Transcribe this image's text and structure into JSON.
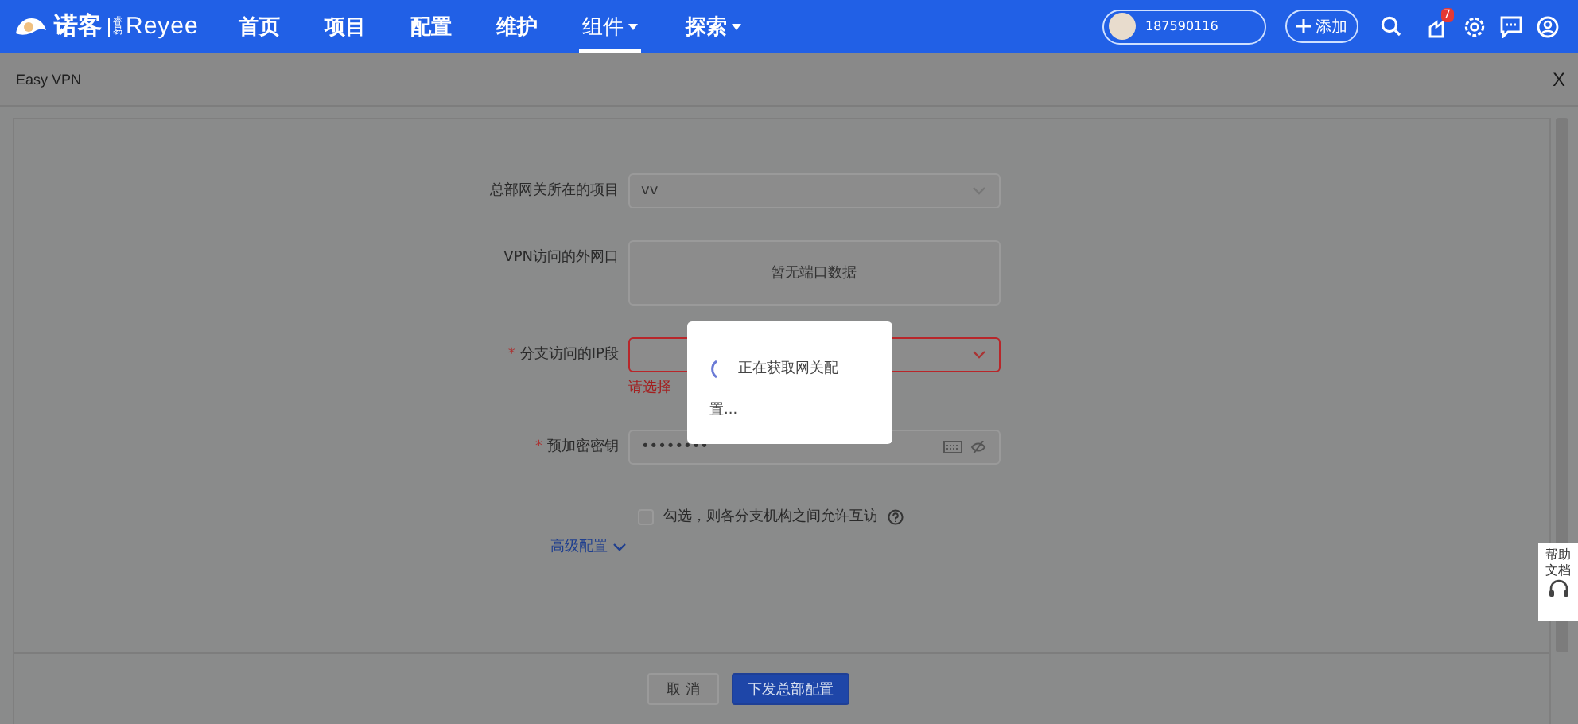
{
  "logo": {
    "name": "诺客",
    "sub": "睿易",
    "brand": "Reyee"
  },
  "nav": [
    {
      "label": "首页",
      "selected": false,
      "dropdown": false
    },
    {
      "label": "项目",
      "selected": false,
      "dropdown": false
    },
    {
      "label": "配置",
      "selected": false,
      "dropdown": false
    },
    {
      "label": "维护",
      "selected": false,
      "dropdown": false
    },
    {
      "label": "组件",
      "selected": true,
      "dropdown": true
    },
    {
      "label": "探索",
      "selected": false,
      "dropdown": true
    }
  ],
  "account": "187590116",
  "add_button": "添加",
  "notification_badge": "7",
  "panel": {
    "title": "Easy VPN",
    "close": "X"
  },
  "form": [
    {
      "kind": "select",
      "label": "总部网关所在的项目",
      "value": "vv",
      "error": false
    },
    {
      "kind": "empty",
      "label": "VPN访问的外网口",
      "value": "暂无端口数据",
      "error": false
    },
    {
      "kind": "select",
      "label": "分支访问的IP段",
      "marker": "*",
      "error": true,
      "message": "请选择"
    },
    {
      "kind": "password",
      "label": "预加密密钥",
      "marker": "*",
      "value": "••••••••",
      "error": false
    }
  ],
  "checkbox": {
    "label": "勾选，则各分支机构之间允许互访",
    "checked": false
  },
  "advanced_link": "高级配置",
  "buttons": [
    {
      "label": "取 消",
      "kind": "secondary"
    },
    {
      "label": "下发总部配置",
      "kind": "primary"
    }
  ],
  "loading": {
    "text": "正在获取网关配置..."
  },
  "help": "帮助文档"
}
